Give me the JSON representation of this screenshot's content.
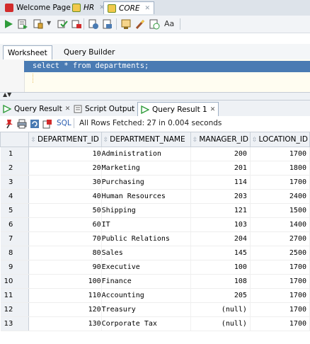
{
  "doc_tabs": [
    {
      "label": "Welcome Page",
      "active": false
    },
    {
      "label": "HR",
      "active": false
    },
    {
      "label": "CORE",
      "active": true
    }
  ],
  "worksheet_tabs": [
    "Worksheet",
    "Query Builder"
  ],
  "editor": {
    "sql": "select * from departments;"
  },
  "result_tabs": [
    {
      "label": "Query Result",
      "active": false
    },
    {
      "label": "Script Output",
      "active": false
    },
    {
      "label": "Query Result 1",
      "active": true
    }
  ],
  "result_toolbar": {
    "sql_label": "SQL",
    "status": "All Rows Fetched: 27 in 0.004 seconds"
  },
  "grid": {
    "columns": [
      "DEPARTMENT_ID",
      "DEPARTMENT_NAME",
      "MANAGER_ID",
      "LOCATION_ID"
    ],
    "rows": [
      [
        "1",
        "10",
        "Administration",
        "200",
        "1700"
      ],
      [
        "2",
        "20",
        "Marketing",
        "201",
        "1800"
      ],
      [
        "3",
        "30",
        "Purchasing",
        "114",
        "1700"
      ],
      [
        "4",
        "40",
        "Human Resources",
        "203",
        "2400"
      ],
      [
        "5",
        "50",
        "Shipping",
        "121",
        "1500"
      ],
      [
        "6",
        "60",
        "IT",
        "103",
        "1400"
      ],
      [
        "7",
        "70",
        "Public Relations",
        "204",
        "2700"
      ],
      [
        "8",
        "80",
        "Sales",
        "145",
        "2500"
      ],
      [
        "9",
        "90",
        "Executive",
        "100",
        "1700"
      ],
      [
        "10",
        "100",
        "Finance",
        "108",
        "1700"
      ],
      [
        "11",
        "110",
        "Accounting",
        "205",
        "1700"
      ],
      [
        "12",
        "120",
        "Treasury",
        "(null)",
        "1700"
      ],
      [
        "13",
        "130",
        "Corporate Tax",
        "(null)",
        "1700"
      ]
    ]
  },
  "colors": {
    "accent": "#4a7bb3",
    "oracle_red": "#d22b2b",
    "run_green": "#2e9b3a"
  }
}
